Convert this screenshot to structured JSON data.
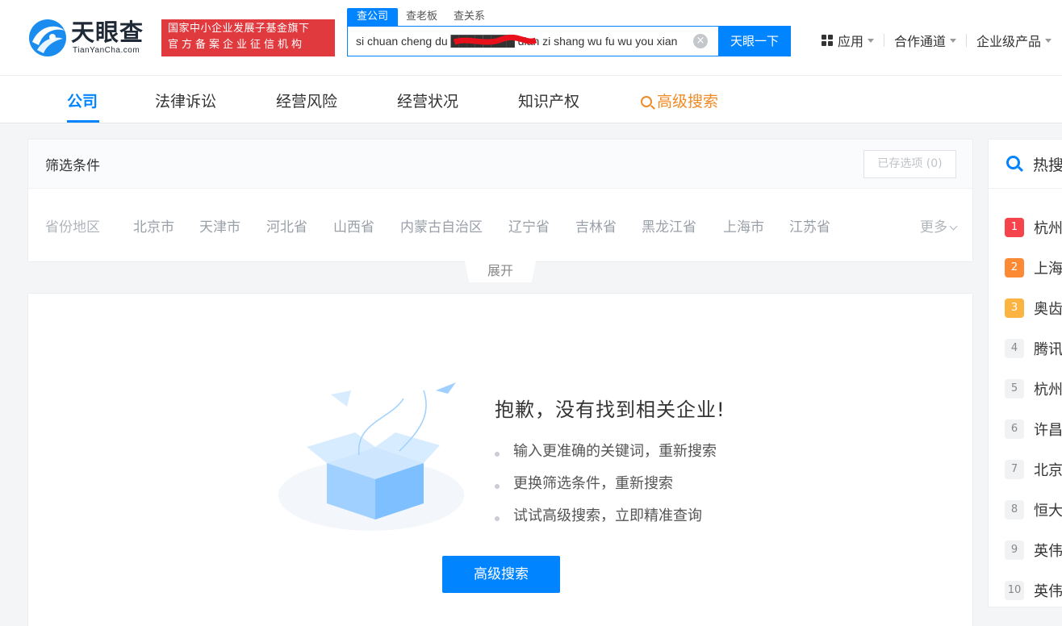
{
  "header": {
    "logo_text": "天眼查",
    "logo_sub": "TianYanCha.com",
    "badge_line1": "国家中小企业发展子基金旗下",
    "badge_line2": "官方备案企业征信机构",
    "search_tabs": [
      "查公司",
      "查老板",
      "查关系"
    ],
    "search_value": "si chuan cheng du ████████ dian zi shang wu fu wu you xian",
    "search_button": "天眼一下",
    "nav": [
      "应用",
      "合作通道",
      "企业级产品"
    ]
  },
  "categories": [
    "公司",
    "法律诉讼",
    "经营风险",
    "经营状况",
    "知识产权",
    "高级搜索"
  ],
  "filter": {
    "title": "筛选条件",
    "saved_button": "已存选项 (0)",
    "region_label": "省份地区",
    "regions": [
      "北京市",
      "天津市",
      "河北省",
      "山西省",
      "内蒙古自治区",
      "辽宁省",
      "吉林省",
      "黑龙江省",
      "上海市",
      "江苏省"
    ],
    "more": "更多",
    "expand": "展开"
  },
  "empty": {
    "title": "抱歉，没有找到相关企业!",
    "tips": [
      "输入更准确的关键词，重新搜索",
      "更换筛选条件，重新搜索",
      "试试高级搜索，立即精准查询"
    ],
    "button": "高级搜索"
  },
  "hot": {
    "title": "热搜",
    "items": [
      {
        "rank": "1",
        "name": "杭州"
      },
      {
        "rank": "2",
        "name": "上海"
      },
      {
        "rank": "3",
        "name": "奥齿"
      },
      {
        "rank": "4",
        "name": "腾讯"
      },
      {
        "rank": "5",
        "name": "杭州"
      },
      {
        "rank": "6",
        "name": "许昌"
      },
      {
        "rank": "7",
        "name": "北京"
      },
      {
        "rank": "8",
        "name": "恒大"
      },
      {
        "rank": "9",
        "name": "英伟"
      },
      {
        "rank": "10",
        "name": "英伟"
      }
    ]
  },
  "colors": {
    "accent": "#0084ff",
    "badge_red": "#e0393e",
    "advanced_orange": "#f08a24",
    "rank1": "#f5444b",
    "rank2": "#fc8a35",
    "rank3": "#fbb441"
  }
}
